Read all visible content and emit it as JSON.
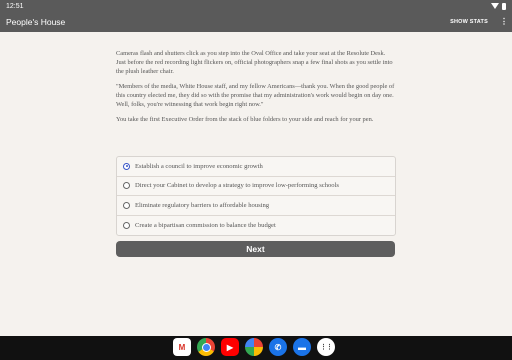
{
  "status_bar": {
    "time": "12:51"
  },
  "app_bar": {
    "title": "People's House",
    "show_stats_label": "SHOW STATS",
    "menu_glyph": "⋮"
  },
  "story": {
    "paragraphs": [
      "Cameras flash and shutters click as you step into the Oval Office and take your seat at the Resolute Desk. Just before the red recording light flickers on, official photographers snap a few final shots as you settle into the plush leather chair.",
      "\"Members of the media, White House staff, and my fellow Americans—thank you. When the good people of this country elected me, they did so with the promise that my administration's work would begin on day one. Well, folks, you're witnessing that work begin right now.\"",
      "You take the first Executive Order from the stack of blue folders to your side and reach for your pen."
    ]
  },
  "choices": [
    {
      "label": "Establish a council to improve economic growth",
      "selected": true
    },
    {
      "label": "Direct your Cabinet to develop a strategy to improve low-performing schools",
      "selected": false
    },
    {
      "label": "Eliminate regulatory barriers to affordable housing",
      "selected": false
    },
    {
      "label": "Create a bipartisan commission to balance the budget",
      "selected": false
    }
  ],
  "next_button": {
    "label": "Next"
  },
  "dock": {
    "apps": [
      {
        "name": "gmail-icon",
        "glyph": "M"
      },
      {
        "name": "chrome-icon",
        "glyph": ""
      },
      {
        "name": "youtube-icon",
        "glyph": "▶"
      },
      {
        "name": "photos-icon",
        "glyph": ""
      },
      {
        "name": "phone-icon",
        "glyph": "✆"
      },
      {
        "name": "messages-icon",
        "glyph": "▬"
      },
      {
        "name": "app-drawer-icon",
        "glyph": "⋮⋮"
      }
    ]
  },
  "colors": {
    "app_bar": "#5a5a5a",
    "page_background": "#f5f2ee",
    "radio_accent": "#3a56c8"
  }
}
